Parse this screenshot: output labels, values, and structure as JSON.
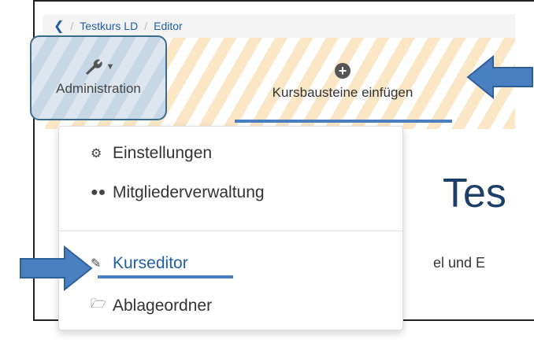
{
  "breadcrumb": {
    "back_icon": "chevron-left-icon",
    "separator": "/",
    "items": [
      {
        "label": "Testkurs LD"
      },
      {
        "label": "Editor"
      }
    ]
  },
  "toolbar": {
    "administration": {
      "label": "Administration",
      "icon": "wrench-icon"
    },
    "insert": {
      "label": "Kursbausteine einfügen",
      "icon": "plus-circle-icon"
    }
  },
  "menu": {
    "items": [
      {
        "label": "Einstellungen",
        "icon": "cogs-icon"
      },
      {
        "label": "Mitgliederverwaltung",
        "icon": "users-icon"
      },
      {
        "label": "Kurseditor",
        "icon": "edit-icon"
      },
      {
        "label": "Ablageordner",
        "icon": "folder-icon"
      }
    ]
  },
  "content": {
    "title": "Tes",
    "text": "el und E"
  },
  "colors": {
    "accent": "#4a7fc1",
    "link": "#1f5ea6",
    "stripe": "#fbe6c6"
  }
}
